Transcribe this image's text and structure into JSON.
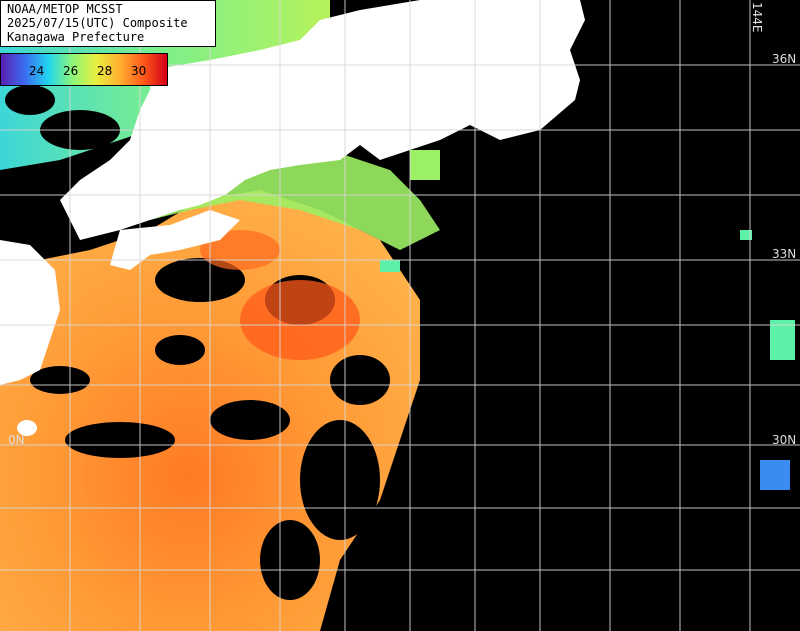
{
  "header": {
    "line1": "NOAA/METOP MCSST",
    "line2": "2025/07/15(UTC) Composite",
    "line3": "Kanagawa Prefecture"
  },
  "colorbar": {
    "ticks": [
      "24",
      "26",
      "28",
      "30"
    ],
    "colors": [
      "#5a1fb0",
      "#3a6cf0",
      "#22d6f0",
      "#8cf57a",
      "#e8f040",
      "#ffb030",
      "#ff5a1a",
      "#d40018"
    ]
  },
  "grid": {
    "lat_labels": [
      "36N",
      "33N",
      "30N"
    ],
    "lon_labels": [
      "144E"
    ],
    "partial_label": "0N"
  },
  "colors": {
    "land": "#ffffff",
    "no_data": "#000000",
    "grid": "#d8d8d8",
    "sst_warm": "#ff8a2a",
    "sst_cool": "#5cf0a8"
  }
}
